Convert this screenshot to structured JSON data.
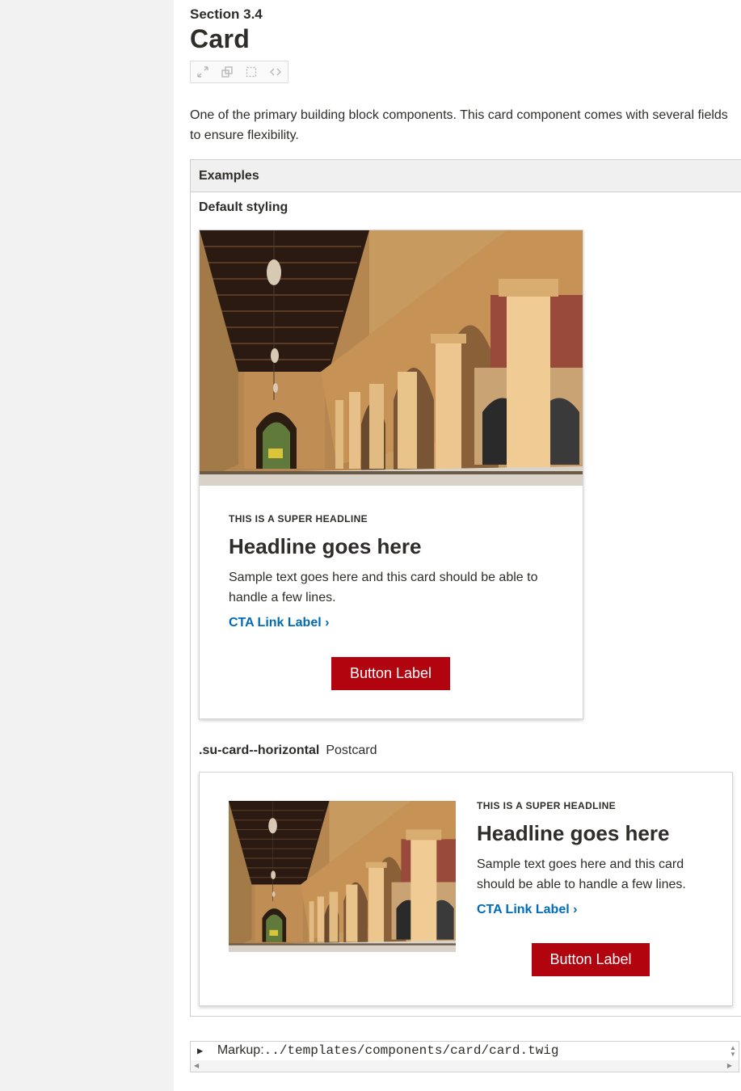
{
  "section": {
    "label": "Section 3.4",
    "title": "Card"
  },
  "toolbar": {
    "icons": [
      "expand-icon",
      "new-window-icon",
      "outline-icon",
      "code-icon"
    ]
  },
  "description": "One of the primary building block components. This card component comes with several fields to ensure flexibility.",
  "examples": {
    "heading": "Examples",
    "default_label": "Default styling",
    "default_card": {
      "super_headline": "THIS IS A SUPER HEADLINE",
      "headline": "Headline goes here",
      "text": "Sample text goes here and this card should be able to handle a few lines.",
      "cta": "CTA Link Label ›",
      "button": "Button Label"
    },
    "horizontal_label": ".su-card--horizontal",
    "horizontal_desc": "Postcard",
    "horizontal_card": {
      "super_headline": "THIS IS A SUPER HEADLINE",
      "headline": "Headline goes here",
      "text": "Sample text goes here and this card should be able to handle a few lines.",
      "cta": "CTA Link Label ›",
      "button": "Button Label"
    }
  },
  "markup": {
    "toggle": "▶",
    "label": "Markup:",
    "path": "../templates/components/card/card.twig"
  },
  "colors": {
    "brand_red": "#b1040e",
    "link_blue": "#006cb8",
    "text": "#2e2d29",
    "sidebar": "#f2f2f2"
  }
}
